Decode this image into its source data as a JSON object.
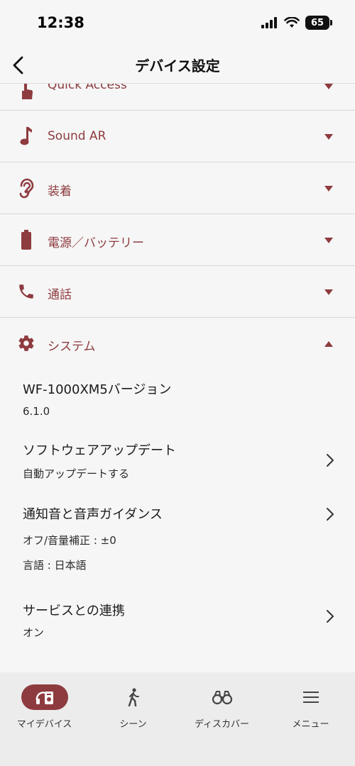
{
  "status_bar": {
    "time": "12:38",
    "battery": "65"
  },
  "header": {
    "title": "デバイス設定"
  },
  "sections": [
    {
      "label": "Quick Access",
      "icon": "touch-icon",
      "expanded": false
    },
    {
      "label": "Sound AR",
      "icon": "music-note-icon",
      "expanded": false
    },
    {
      "label": "装着",
      "icon": "ear-icon",
      "expanded": false
    },
    {
      "label": "電源／バッテリー",
      "icon": "battery-icon",
      "expanded": false
    },
    {
      "label": "通話",
      "icon": "phone-icon",
      "expanded": false
    },
    {
      "label": "システム",
      "icon": "gear-icon",
      "expanded": true
    }
  ],
  "system_items": [
    {
      "title": "WF-1000XM5バージョン",
      "lines": [
        "6.1.0"
      ],
      "has_chevron": false
    },
    {
      "title": "ソフトウェアアップデート",
      "lines": [
        "自動アップデートする"
      ],
      "has_chevron": true
    },
    {
      "title": "通知音と音声ガイダンス",
      "lines": [
        "オフ/音量補正 : ±0",
        "言語 : 日本語"
      ],
      "has_chevron": true
    },
    {
      "title": "サービスとの連携",
      "lines": [
        "オン"
      ],
      "has_chevron": true
    }
  ],
  "tabs": [
    {
      "label": "マイデバイス",
      "icon": "headphones-device-icon",
      "active": true
    },
    {
      "label": "シーン",
      "icon": "walking-person-icon",
      "active": false
    },
    {
      "label": "ディスカバー",
      "icon": "binoculars-icon",
      "active": false
    },
    {
      "label": "メニュー",
      "icon": "hamburger-menu-icon",
      "active": false
    }
  ],
  "colors": {
    "accent": "#8e3b3f",
    "background": "#f6f6f6",
    "tab_bar": "#ececec"
  }
}
